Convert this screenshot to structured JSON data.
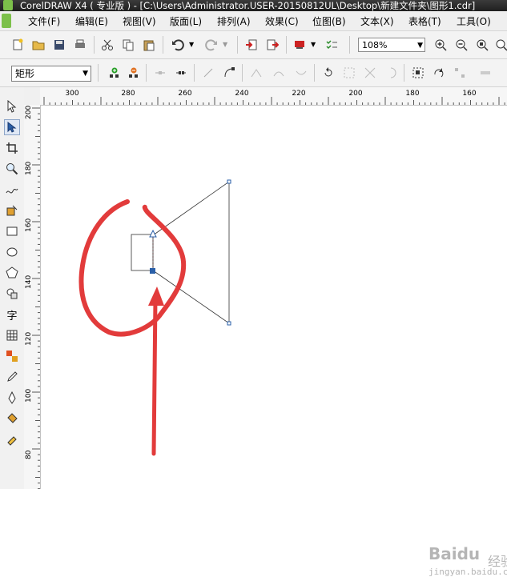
{
  "window": {
    "title": "CorelDRAW X4 ( 专业版 ) - [C:\\Users\\Administrator.USER-20150812UL\\Desktop\\新建文件夹\\图形1.cdr]"
  },
  "menu": [
    "文件(F)",
    "编辑(E)",
    "视图(V)",
    "版面(L)",
    "排列(A)",
    "效果(C)",
    "位图(B)",
    "文本(X)",
    "表格(T)",
    "工具(O)"
  ],
  "toolbar": {
    "zoom_value": "108%"
  },
  "property_bar": {
    "object_type": "矩形"
  },
  "ruler": {
    "horizontal_labels": [
      "300",
      "280",
      "260",
      "240",
      "220",
      "200",
      "180",
      "160"
    ],
    "vertical_labels": [
      "200",
      "180",
      "160",
      "140",
      "120",
      "100",
      "80"
    ]
  },
  "toolbox": {
    "text_tool_glyph": "字"
  },
  "annotation": {
    "color": "#e23b3b"
  },
  "shape_color": "#2a5fa8",
  "watermark": {
    "brand": "Baidu",
    "cn": "经验",
    "url": "jingyan.baidu.com"
  }
}
